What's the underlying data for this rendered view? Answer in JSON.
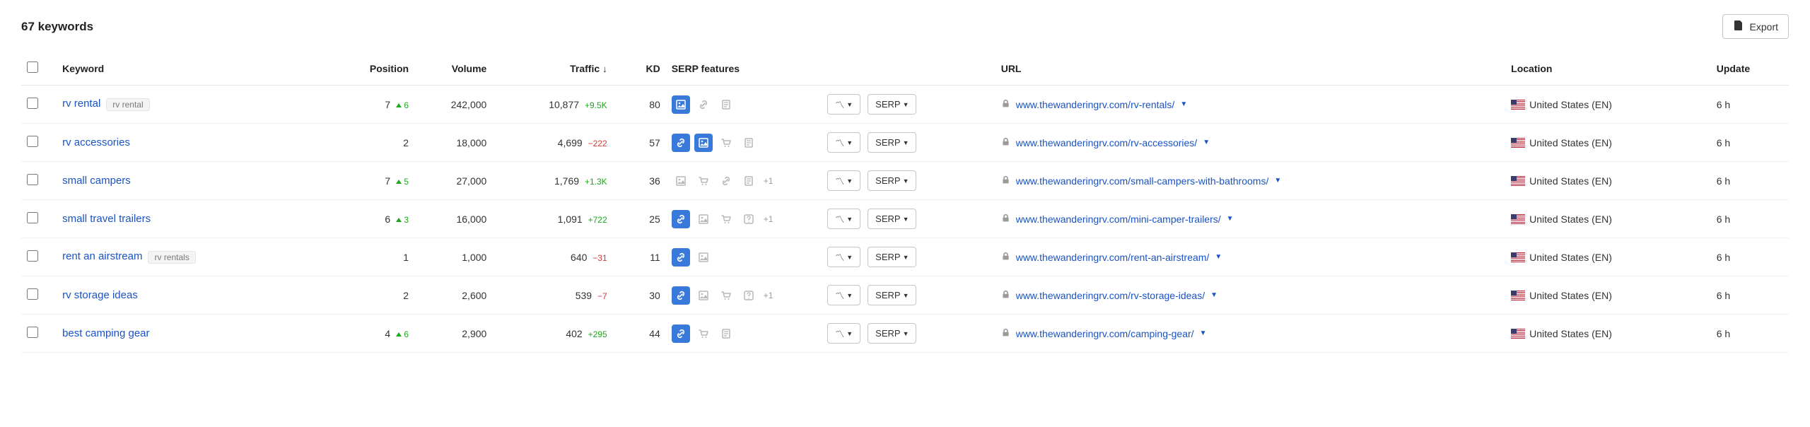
{
  "header": {
    "title": "67 keywords",
    "export_label": "Export"
  },
  "columns": {
    "keyword": "Keyword",
    "position": "Position",
    "volume": "Volume",
    "traffic": "Traffic",
    "kd": "KD",
    "serp_features": "SERP features",
    "url": "URL",
    "location": "Location",
    "update": "Update"
  },
  "actions": {
    "serp_btn": "SERP"
  },
  "rows": [
    {
      "keyword": "rv rental",
      "tag": "rv rental",
      "position": "7",
      "pos_delta": "6",
      "volume": "242,000",
      "traffic": "10,877",
      "traffic_delta": "+9.5K",
      "traffic_dir": "up",
      "kd": "80",
      "features": [
        {
          "glyph": "image",
          "on": true
        },
        {
          "glyph": "link",
          "on": false
        },
        {
          "glyph": "page",
          "on": false
        }
      ],
      "feat_more": "",
      "url": "www.thewanderingrv.com/rv-rentals/",
      "location": "United States (EN)",
      "update": "6 h"
    },
    {
      "keyword": "rv accessories",
      "tag": "",
      "position": "2",
      "pos_delta": "",
      "volume": "18,000",
      "traffic": "4,699",
      "traffic_delta": "−222",
      "traffic_dir": "down",
      "kd": "57",
      "features": [
        {
          "glyph": "link",
          "on": true
        },
        {
          "glyph": "image",
          "on": true
        },
        {
          "glyph": "cart",
          "on": false
        },
        {
          "glyph": "page",
          "on": false
        }
      ],
      "feat_more": "",
      "url": "www.thewanderingrv.com/rv-accessories/",
      "location": "United States (EN)",
      "update": "6 h"
    },
    {
      "keyword": "small campers",
      "tag": "",
      "position": "7",
      "pos_delta": "5",
      "volume": "27,000",
      "traffic": "1,769",
      "traffic_delta": "+1.3K",
      "traffic_dir": "up",
      "kd": "36",
      "features": [
        {
          "glyph": "image",
          "on": false
        },
        {
          "glyph": "cart",
          "on": false
        },
        {
          "glyph": "link",
          "on": false
        },
        {
          "glyph": "page",
          "on": false
        }
      ],
      "feat_more": "+1",
      "url": "www.thewanderingrv.com/small-campers-with-bathrooms/",
      "location": "United States (EN)",
      "update": "6 h"
    },
    {
      "keyword": "small travel trailers",
      "tag": "",
      "position": "6",
      "pos_delta": "3",
      "volume": "16,000",
      "traffic": "1,091",
      "traffic_delta": "+722",
      "traffic_dir": "up",
      "kd": "25",
      "features": [
        {
          "glyph": "link",
          "on": true
        },
        {
          "glyph": "image",
          "on": false
        },
        {
          "glyph": "cart",
          "on": false
        },
        {
          "glyph": "question",
          "on": false
        }
      ],
      "feat_more": "+1",
      "url": "www.thewanderingrv.com/mini-camper-trailers/",
      "location": "United States (EN)",
      "update": "6 h"
    },
    {
      "keyword": "rent an airstream",
      "tag": "rv rentals",
      "position": "1",
      "pos_delta": "",
      "volume": "1,000",
      "traffic": "640",
      "traffic_delta": "−31",
      "traffic_dir": "down",
      "kd": "11",
      "features": [
        {
          "glyph": "link",
          "on": true
        },
        {
          "glyph": "image",
          "on": false
        }
      ],
      "feat_more": "",
      "url": "www.thewanderingrv.com/rent-an-airstream/",
      "location": "United States (EN)",
      "update": "6 h"
    },
    {
      "keyword": "rv storage ideas",
      "tag": "",
      "position": "2",
      "pos_delta": "",
      "volume": "2,600",
      "traffic": "539",
      "traffic_delta": "−7",
      "traffic_dir": "down",
      "kd": "30",
      "features": [
        {
          "glyph": "link",
          "on": true
        },
        {
          "glyph": "image",
          "on": false
        },
        {
          "glyph": "cart",
          "on": false
        },
        {
          "glyph": "question",
          "on": false
        }
      ],
      "feat_more": "+1",
      "url": "www.thewanderingrv.com/rv-storage-ideas/",
      "location": "United States (EN)",
      "update": "6 h"
    },
    {
      "keyword": "best camping gear",
      "tag": "",
      "position": "4",
      "pos_delta": "6",
      "volume": "2,900",
      "traffic": "402",
      "traffic_delta": "+295",
      "traffic_dir": "up",
      "kd": "44",
      "features": [
        {
          "glyph": "link",
          "on": true
        },
        {
          "glyph": "cart",
          "on": false
        },
        {
          "glyph": "page",
          "on": false
        }
      ],
      "feat_more": "",
      "url": "www.thewanderingrv.com/camping-gear/",
      "location": "United States (EN)",
      "update": "6 h"
    }
  ]
}
